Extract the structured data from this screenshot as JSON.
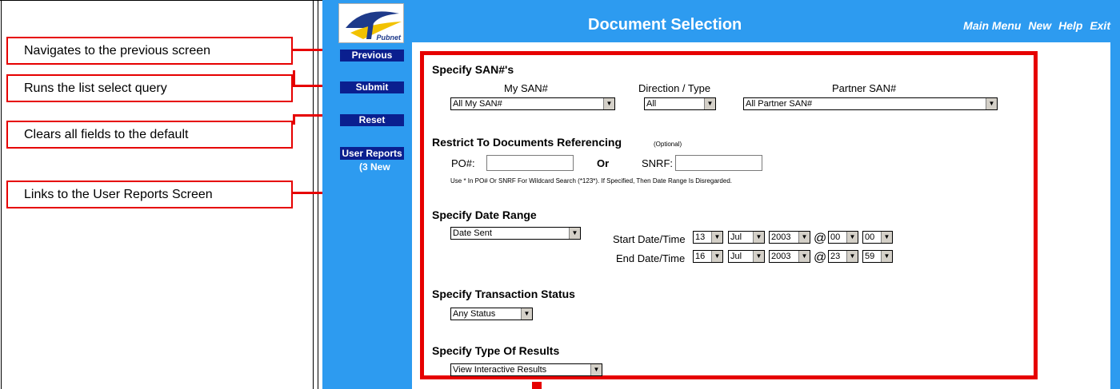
{
  "callouts": {
    "previous": "Navigates to the previous screen",
    "submit": "Runs the list select query",
    "reset": "Clears all fields to the default",
    "reports": "Links to the User Reports Screen"
  },
  "sidebar": {
    "logo_text": "Pubnet",
    "previous": "Previous",
    "submit": "Submit",
    "reset": "Reset",
    "user_reports": "User Reports",
    "new_count": "(3 New"
  },
  "header": {
    "title": "Document Selection",
    "nav": [
      "Main Menu",
      "New",
      "Help",
      "Exit"
    ]
  },
  "san": {
    "heading": "Specify SAN#'s",
    "my_label": "My SAN#",
    "direction_label": "Direction / Type",
    "partner_label": "Partner SAN#",
    "my_value": "All My SAN#",
    "direction_value": "All",
    "partner_value": "All Partner SAN#"
  },
  "restrict": {
    "heading": "Restrict To Documents Referencing",
    "optional": "(Optional)",
    "po_label": "PO#:",
    "or_label": "Or",
    "snrf_label": "SNRF:",
    "po_value": "",
    "snrf_value": "",
    "hint": "Use * In PO# Or SNRF For Wildcard Search (*123*). If Specified, Then Date Range Is Disregarded."
  },
  "date_range": {
    "heading": "Specify Date Range",
    "type_value": "Date Sent",
    "start_label": "Start Date/Time",
    "end_label": "End Date/Time",
    "at": "@",
    "start": {
      "day": "13",
      "month": "Jul",
      "year": "2003",
      "hour": "00",
      "minute": "00"
    },
    "end": {
      "day": "16",
      "month": "Jul",
      "year": "2003",
      "hour": "23",
      "minute": "59"
    }
  },
  "status": {
    "heading": "Specify Transaction Status",
    "value": "Any Status"
  },
  "results": {
    "heading": "Specify Type Of Results",
    "value": "View Interactive Results"
  },
  "colors": {
    "accent_red": "#e60000",
    "app_blue": "#2d9bf0",
    "button_navy": "#0a1f8f"
  }
}
